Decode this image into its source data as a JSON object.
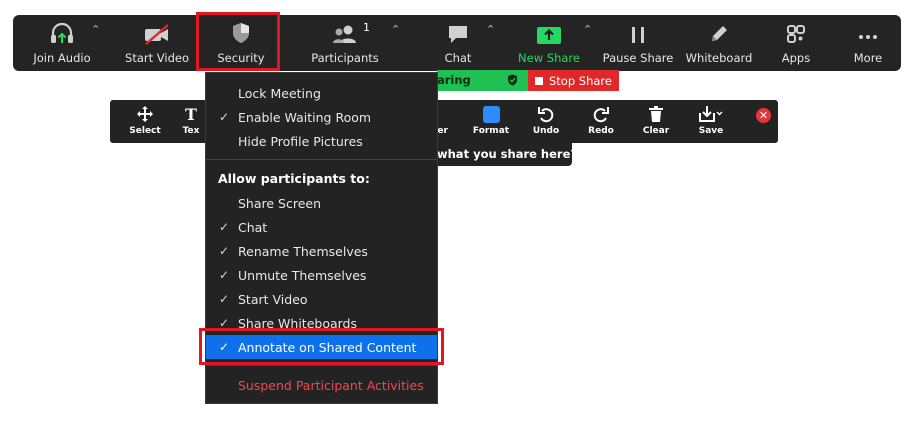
{
  "toolbar": {
    "join_audio": "Join Audio",
    "start_video": "Start Video",
    "security": "Security",
    "participants": "Participants",
    "participants_count": "1",
    "chat": "Chat",
    "new_share": "New Share",
    "pause_share": "Pause Share",
    "whiteboard": "Whiteboard",
    "apps": "Apps",
    "more": "More"
  },
  "share_status": {
    "sharing_label": "aring",
    "stop_share_label": "Stop Share"
  },
  "annotation": {
    "select": "Select",
    "text": "Tex",
    "eraser": "ser",
    "format": "Format",
    "undo": "Undo",
    "redo": "Redo",
    "clear": "Clear",
    "save": "Save"
  },
  "share_prompt": "what you share here?",
  "security_menu": {
    "lock_meeting": "Lock Meeting",
    "enable_waiting_room": "Enable Waiting Room",
    "hide_profile_pictures": "Hide Profile Pictures",
    "allow_header": "Allow participants to:",
    "share_screen": "Share Screen",
    "chat": "Chat",
    "rename_themselves": "Rename Themselves",
    "unmute_themselves": "Unmute Themselves",
    "start_video": "Start Video",
    "share_whiteboards": "Share Whiteboards",
    "annotate_on_shared_content": "Annotate on Shared Content",
    "suspend_participant_activities": "Suspend Participant Activities"
  },
  "colors": {
    "toolbar_bg": "#242424",
    "highlight_red": "#e01622",
    "selection_blue": "#0e71eb",
    "share_green": "#1fc153",
    "stop_red": "#e02828",
    "danger_text": "#f0484f"
  }
}
